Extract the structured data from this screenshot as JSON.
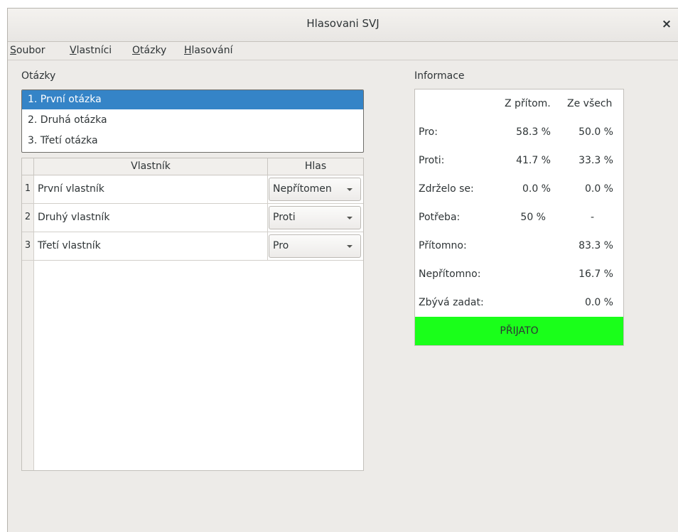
{
  "window": {
    "title": "Hlasovani SVJ",
    "close_glyph": "×"
  },
  "menu": {
    "items": [
      {
        "mnemonic": "S",
        "rest": "oubor"
      },
      {
        "mnemonic": "V",
        "rest": "lastníci"
      },
      {
        "mnemonic": "O",
        "rest": "tázky"
      },
      {
        "mnemonic": "H",
        "rest": "lasování"
      }
    ]
  },
  "questions": {
    "label": "Otázky",
    "items": [
      {
        "label": "1. První otázka",
        "selected": true
      },
      {
        "label": "2. Druhá otázka",
        "selected": false
      },
      {
        "label": "3. Třetí otázka",
        "selected": false
      }
    ]
  },
  "owners_table": {
    "headers": {
      "owner": "Vlastník",
      "vote": "Hlas"
    },
    "rows": [
      {
        "num": "1",
        "owner": "První vlastník",
        "vote": "Nepřítomen"
      },
      {
        "num": "2",
        "owner": "Druhý vlastník",
        "vote": "Proti"
      },
      {
        "num": "3",
        "owner": "Třetí vlastník",
        "vote": "Pro"
      }
    ]
  },
  "info": {
    "label": "Informace",
    "col_present": "Z přítom.",
    "col_all": "Ze všech",
    "rows": [
      {
        "label": "Pro:",
        "present": "58.3 %",
        "all": "50.0 %"
      },
      {
        "label": "Proti:",
        "present": "41.7 %",
        "all": "33.3 %"
      },
      {
        "label": "Zdrželo se:",
        "present": "0.0 %",
        "all": "0.0 %"
      },
      {
        "label": "Potřeba:",
        "present": "50 %",
        "all": "-"
      },
      {
        "label": "Přítomno:",
        "present": "",
        "all": "83.3 %"
      },
      {
        "label": "Nepřítomno:",
        "present": "",
        "all": "16.7 %"
      },
      {
        "label": "Zbývá zadat:",
        "present": "",
        "all": "0.0 %"
      }
    ],
    "result": "PŘIJATO",
    "result_color": "#1aff1a"
  },
  "colors": {
    "selection": "#3584c7",
    "window_bg": "#edebe8"
  }
}
